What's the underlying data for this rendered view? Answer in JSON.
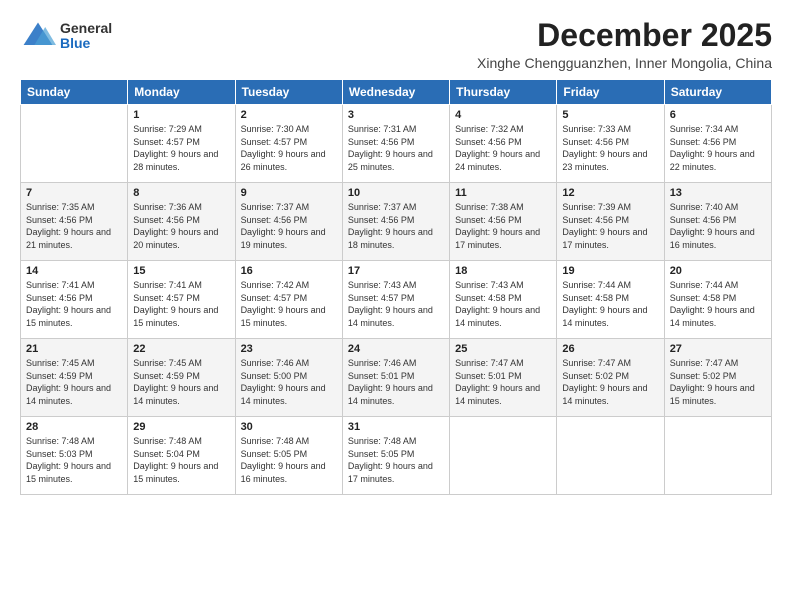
{
  "logo": {
    "general": "General",
    "blue": "Blue"
  },
  "title": "December 2025",
  "subtitle": "Xinghe Chengguanzhen, Inner Mongolia, China",
  "headers": [
    "Sunday",
    "Monday",
    "Tuesday",
    "Wednesday",
    "Thursday",
    "Friday",
    "Saturday"
  ],
  "weeks": [
    [
      {
        "day": "",
        "sunrise": "",
        "sunset": "",
        "daylight": ""
      },
      {
        "day": "1",
        "sunrise": "Sunrise: 7:29 AM",
        "sunset": "Sunset: 4:57 PM",
        "daylight": "Daylight: 9 hours and 28 minutes."
      },
      {
        "day": "2",
        "sunrise": "Sunrise: 7:30 AM",
        "sunset": "Sunset: 4:57 PM",
        "daylight": "Daylight: 9 hours and 26 minutes."
      },
      {
        "day": "3",
        "sunrise": "Sunrise: 7:31 AM",
        "sunset": "Sunset: 4:56 PM",
        "daylight": "Daylight: 9 hours and 25 minutes."
      },
      {
        "day": "4",
        "sunrise": "Sunrise: 7:32 AM",
        "sunset": "Sunset: 4:56 PM",
        "daylight": "Daylight: 9 hours and 24 minutes."
      },
      {
        "day": "5",
        "sunrise": "Sunrise: 7:33 AM",
        "sunset": "Sunset: 4:56 PM",
        "daylight": "Daylight: 9 hours and 23 minutes."
      },
      {
        "day": "6",
        "sunrise": "Sunrise: 7:34 AM",
        "sunset": "Sunset: 4:56 PM",
        "daylight": "Daylight: 9 hours and 22 minutes."
      }
    ],
    [
      {
        "day": "7",
        "sunrise": "Sunrise: 7:35 AM",
        "sunset": "Sunset: 4:56 PM",
        "daylight": "Daylight: 9 hours and 21 minutes."
      },
      {
        "day": "8",
        "sunrise": "Sunrise: 7:36 AM",
        "sunset": "Sunset: 4:56 PM",
        "daylight": "Daylight: 9 hours and 20 minutes."
      },
      {
        "day": "9",
        "sunrise": "Sunrise: 7:37 AM",
        "sunset": "Sunset: 4:56 PM",
        "daylight": "Daylight: 9 hours and 19 minutes."
      },
      {
        "day": "10",
        "sunrise": "Sunrise: 7:37 AM",
        "sunset": "Sunset: 4:56 PM",
        "daylight": "Daylight: 9 hours and 18 minutes."
      },
      {
        "day": "11",
        "sunrise": "Sunrise: 7:38 AM",
        "sunset": "Sunset: 4:56 PM",
        "daylight": "Daylight: 9 hours and 17 minutes."
      },
      {
        "day": "12",
        "sunrise": "Sunrise: 7:39 AM",
        "sunset": "Sunset: 4:56 PM",
        "daylight": "Daylight: 9 hours and 17 minutes."
      },
      {
        "day": "13",
        "sunrise": "Sunrise: 7:40 AM",
        "sunset": "Sunset: 4:56 PM",
        "daylight": "Daylight: 9 hours and 16 minutes."
      }
    ],
    [
      {
        "day": "14",
        "sunrise": "Sunrise: 7:41 AM",
        "sunset": "Sunset: 4:56 PM",
        "daylight": "Daylight: 9 hours and 15 minutes."
      },
      {
        "day": "15",
        "sunrise": "Sunrise: 7:41 AM",
        "sunset": "Sunset: 4:57 PM",
        "daylight": "Daylight: 9 hours and 15 minutes."
      },
      {
        "day": "16",
        "sunrise": "Sunrise: 7:42 AM",
        "sunset": "Sunset: 4:57 PM",
        "daylight": "Daylight: 9 hours and 15 minutes."
      },
      {
        "day": "17",
        "sunrise": "Sunrise: 7:43 AM",
        "sunset": "Sunset: 4:57 PM",
        "daylight": "Daylight: 9 hours and 14 minutes."
      },
      {
        "day": "18",
        "sunrise": "Sunrise: 7:43 AM",
        "sunset": "Sunset: 4:58 PM",
        "daylight": "Daylight: 9 hours and 14 minutes."
      },
      {
        "day": "19",
        "sunrise": "Sunrise: 7:44 AM",
        "sunset": "Sunset: 4:58 PM",
        "daylight": "Daylight: 9 hours and 14 minutes."
      },
      {
        "day": "20",
        "sunrise": "Sunrise: 7:44 AM",
        "sunset": "Sunset: 4:58 PM",
        "daylight": "Daylight: 9 hours and 14 minutes."
      }
    ],
    [
      {
        "day": "21",
        "sunrise": "Sunrise: 7:45 AM",
        "sunset": "Sunset: 4:59 PM",
        "daylight": "Daylight: 9 hours and 14 minutes."
      },
      {
        "day": "22",
        "sunrise": "Sunrise: 7:45 AM",
        "sunset": "Sunset: 4:59 PM",
        "daylight": "Daylight: 9 hours and 14 minutes."
      },
      {
        "day": "23",
        "sunrise": "Sunrise: 7:46 AM",
        "sunset": "Sunset: 5:00 PM",
        "daylight": "Daylight: 9 hours and 14 minutes."
      },
      {
        "day": "24",
        "sunrise": "Sunrise: 7:46 AM",
        "sunset": "Sunset: 5:01 PM",
        "daylight": "Daylight: 9 hours and 14 minutes."
      },
      {
        "day": "25",
        "sunrise": "Sunrise: 7:47 AM",
        "sunset": "Sunset: 5:01 PM",
        "daylight": "Daylight: 9 hours and 14 minutes."
      },
      {
        "day": "26",
        "sunrise": "Sunrise: 7:47 AM",
        "sunset": "Sunset: 5:02 PM",
        "daylight": "Daylight: 9 hours and 14 minutes."
      },
      {
        "day": "27",
        "sunrise": "Sunrise: 7:47 AM",
        "sunset": "Sunset: 5:02 PM",
        "daylight": "Daylight: 9 hours and 15 minutes."
      }
    ],
    [
      {
        "day": "28",
        "sunrise": "Sunrise: 7:48 AM",
        "sunset": "Sunset: 5:03 PM",
        "daylight": "Daylight: 9 hours and 15 minutes."
      },
      {
        "day": "29",
        "sunrise": "Sunrise: 7:48 AM",
        "sunset": "Sunset: 5:04 PM",
        "daylight": "Daylight: 9 hours and 15 minutes."
      },
      {
        "day": "30",
        "sunrise": "Sunrise: 7:48 AM",
        "sunset": "Sunset: 5:05 PM",
        "daylight": "Daylight: 9 hours and 16 minutes."
      },
      {
        "day": "31",
        "sunrise": "Sunrise: 7:48 AM",
        "sunset": "Sunset: 5:05 PM",
        "daylight": "Daylight: 9 hours and 17 minutes."
      },
      {
        "day": "",
        "sunrise": "",
        "sunset": "",
        "daylight": ""
      },
      {
        "day": "",
        "sunrise": "",
        "sunset": "",
        "daylight": ""
      },
      {
        "day": "",
        "sunrise": "",
        "sunset": "",
        "daylight": ""
      }
    ]
  ]
}
